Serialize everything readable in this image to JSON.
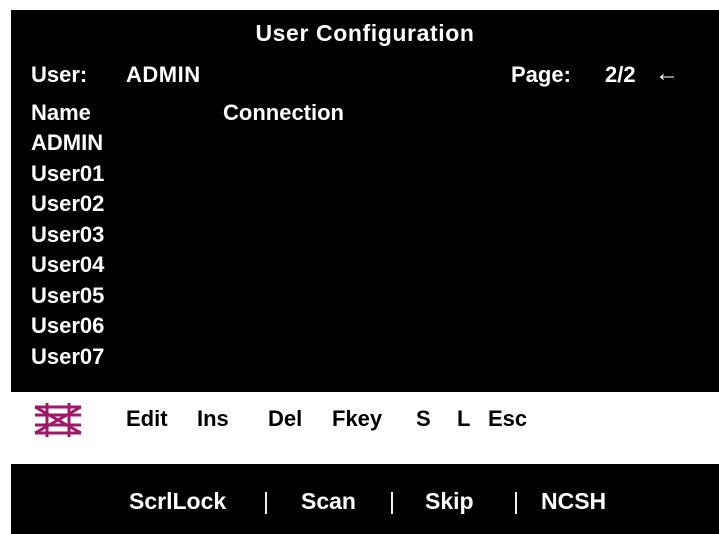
{
  "header": {
    "title": "User Configuration",
    "user_label": "User:",
    "user_value": "ADMIN",
    "page_label": "Page:",
    "page_value": "2/2",
    "back_arrow": "←"
  },
  "table": {
    "columns": [
      "Name",
      "Connection"
    ],
    "rows": [
      "ADMIN",
      "User01",
      "User02",
      "User03",
      "User04",
      "User05",
      "User06",
      "User07"
    ]
  },
  "function_bar": {
    "keys": [
      "Edit",
      "Ins",
      "Del",
      "Fkey",
      "S",
      "L",
      "Esc"
    ]
  },
  "status_bar": {
    "items": [
      "ScrlLock",
      "Scan",
      "Skip",
      "NCSH"
    ],
    "separator": "|"
  },
  "colors": {
    "background": "#000000",
    "text": "#ffffff",
    "function_bar_bg": "#ffffff",
    "logo": "#a0186a"
  },
  "icons": {
    "logo": "brand-logo-icon",
    "back": "back-arrow-icon"
  }
}
